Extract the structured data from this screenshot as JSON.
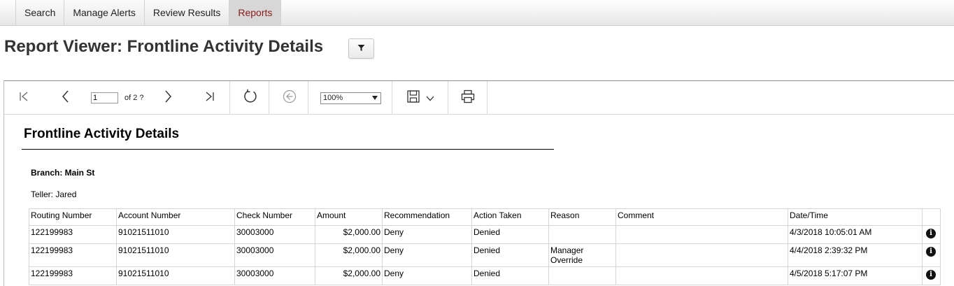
{
  "nav": {
    "tabs": [
      {
        "label": "Search"
      },
      {
        "label": "Manage Alerts"
      },
      {
        "label": "Review Results"
      },
      {
        "label": "Reports"
      }
    ],
    "active_tab": "Reports"
  },
  "header": {
    "title": "Report Viewer: Frontline Activity Details",
    "filter_icon": "filter-icon"
  },
  "toolbar": {
    "page_value": "1",
    "page_of": "of 2 ?",
    "zoom": "100%",
    "icons": [
      "first-page-icon",
      "prev-page-icon",
      "next-page-icon",
      "last-page-icon",
      "refresh-icon",
      "back-icon",
      "save-icon",
      "chevron-down-icon",
      "print-icon"
    ]
  },
  "report": {
    "title": "Frontline Activity Details",
    "branch": "Branch: Main St",
    "teller": "Teller: Jared",
    "columns": [
      "Routing Number",
      "Account Number",
      "Check Number",
      "Amount",
      "Recommendation",
      "Action Taken",
      "Reason",
      "Comment",
      "Date/Time",
      ""
    ],
    "rows": [
      {
        "routing": "122199983",
        "account": "91021511010",
        "check": "30003000",
        "amount": "$2,000.00",
        "recommendation": "Deny",
        "action": "Denied",
        "reason": "",
        "comment": "",
        "datetime": "4/3/2018 10:05:01 AM"
      },
      {
        "routing": "122199983",
        "account": "91021511010",
        "check": "30003000",
        "amount": "$2,000.00",
        "recommendation": "Deny",
        "action": "Denied",
        "reason": "Manager Override",
        "comment": "",
        "datetime": "4/4/2018 2:39:32 PM"
      },
      {
        "routing": "122199983",
        "account": "91021511010",
        "check": "30003000",
        "amount": "$2,000.00",
        "recommendation": "Deny",
        "action": "Denied",
        "reason": "",
        "comment": "",
        "datetime": "4/5/2018 5:17:07 PM"
      }
    ]
  },
  "colors": {
    "active_tab_text": "#8a1a1a"
  }
}
